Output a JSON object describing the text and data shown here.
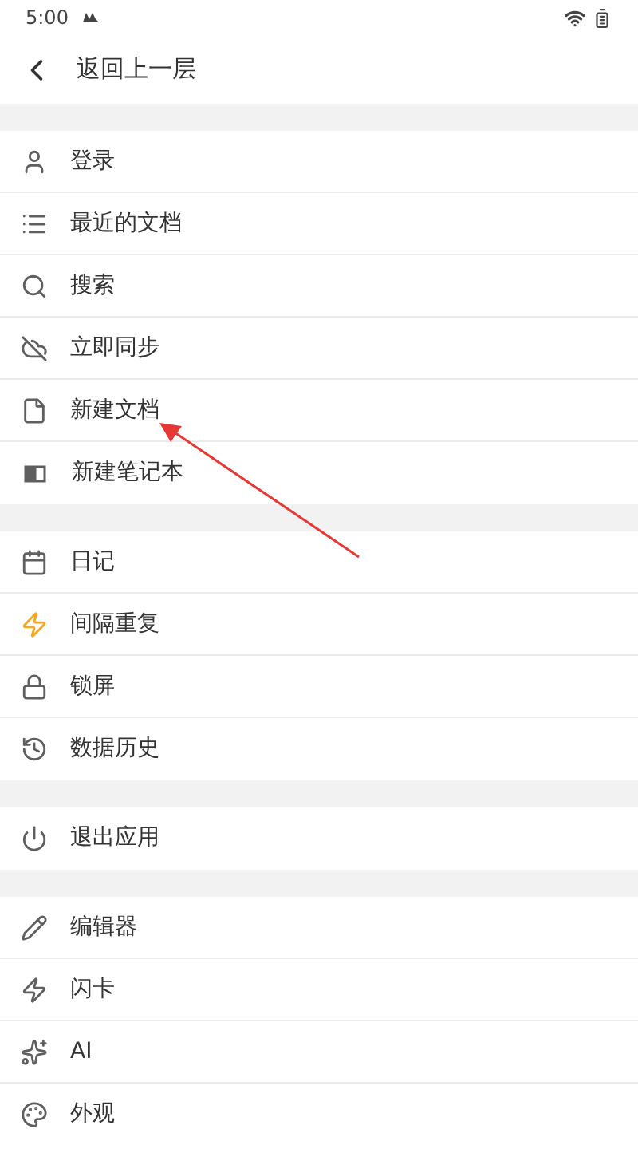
{
  "status_bar": {
    "time": "5:00"
  },
  "header": {
    "title": "返回上一层"
  },
  "sections": [
    {
      "items": [
        {
          "label": "登录",
          "color": "#5f5f5f"
        },
        {
          "label": "最近的文档",
          "color": "#5f5f5f"
        },
        {
          "label": "搜索",
          "color": "#5f5f5f"
        },
        {
          "label": "立即同步",
          "color": "#5f5f5f"
        },
        {
          "label": "新建文档",
          "color": "#5f5f5f"
        },
        {
          "label": "新建笔记本",
          "color": "#5f5f5f"
        }
      ]
    },
    {
      "items": [
        {
          "label": "日记",
          "color": "#5f5f5f"
        },
        {
          "label": "间隔重复",
          "color": "#f5a623"
        },
        {
          "label": "锁屏",
          "color": "#5f5f5f"
        },
        {
          "label": "数据历史",
          "color": "#5f5f5f"
        }
      ]
    },
    {
      "items": [
        {
          "label": "退出应用",
          "color": "#5f5f5f"
        }
      ]
    },
    {
      "items": [
        {
          "label": "编辑器",
          "color": "#5f5f5f"
        },
        {
          "label": "闪卡",
          "color": "#5f5f5f"
        },
        {
          "label": "AI",
          "color": "#5f5f5f"
        },
        {
          "label": "外观",
          "color": "#5f5f5f"
        }
      ]
    }
  ]
}
